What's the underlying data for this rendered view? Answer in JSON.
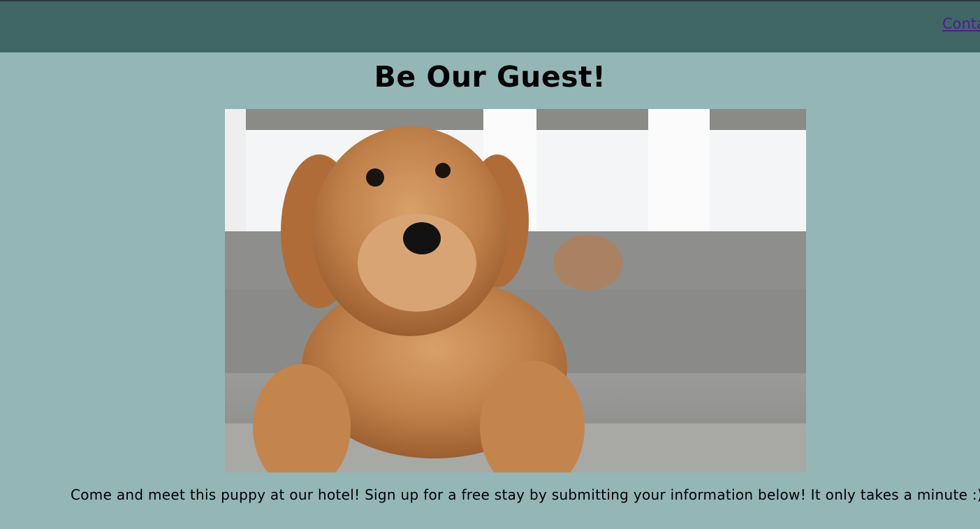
{
  "header": {
    "nav_link_label": "Conta"
  },
  "main": {
    "title": "Be Our Guest!",
    "image": {
      "subject": "puppy-photo"
    },
    "caption": "Come and meet this puppy at our hotel! Sign up for a free stay by submitting your information below! It only takes a minute :)"
  },
  "colors": {
    "page_background": "#94b6b6",
    "header_background": "#406666",
    "link": "#4b1f8c"
  }
}
